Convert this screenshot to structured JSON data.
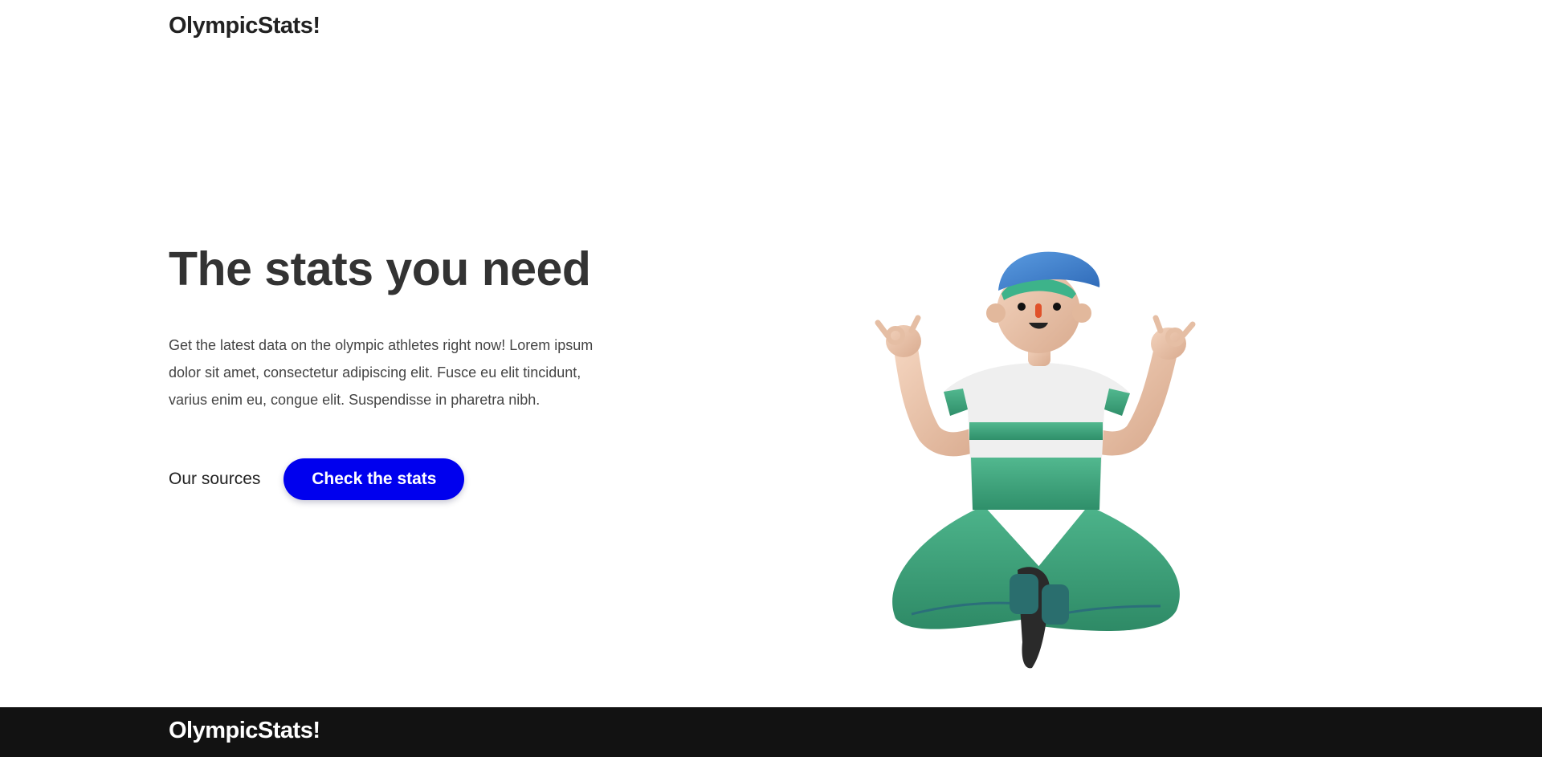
{
  "header": {
    "logo": "OlympicStats!"
  },
  "hero": {
    "title": "The stats you need",
    "description": "Get the latest data on the olympic athletes right now! Lorem ipsum dolor sit amet, consectetur adipiscing elit. Fusce eu elit tincidunt, varius enim eu, congue elit. Suspendisse in pharetra nibh.",
    "secondary_link": "Our sources",
    "primary_button": "Check the stats"
  },
  "footer": {
    "logo": "OlympicStats!"
  },
  "colors": {
    "primary_button": "#0000ee",
    "footer_background": "#121212",
    "shirt_green": "#3fa77f",
    "cap_blue": "#3b7fd0"
  },
  "icons": {
    "illustration": "meditating-person-illustration"
  }
}
